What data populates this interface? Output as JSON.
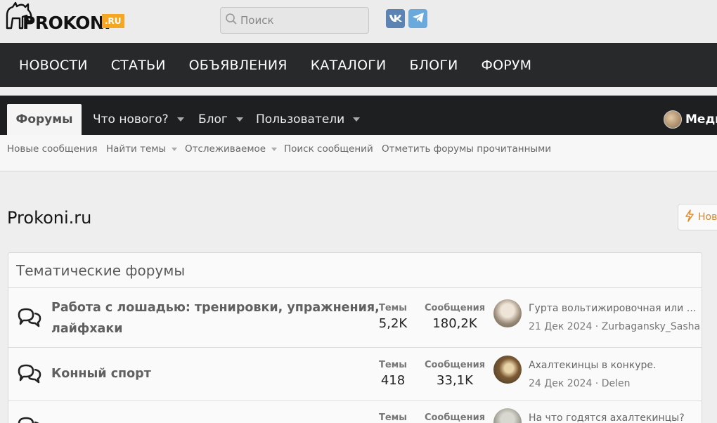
{
  "logo": {
    "text": "PROKONI",
    "suffix": ".RU"
  },
  "search": {
    "placeholder": "Поиск"
  },
  "social": {
    "vk": "vk-icon",
    "telegram": "telegram-icon"
  },
  "main_nav": [
    "НОВОСТИ",
    "СТАТЬИ",
    "ОБЪЯВЛЕНИЯ",
    "КАТАЛОГИ",
    "БЛОГИ",
    "ФОРУМ"
  ],
  "forum_nav": {
    "active": "Форумы",
    "whats_new": "Что нового?",
    "blog": "Блог",
    "users": "Пользователи",
    "user_name": "Медв"
  },
  "sub_nav": {
    "new_posts": "Новые сообщения",
    "find_threads": "Найти темы",
    "watched": "Отслеживаемое",
    "search_posts": "Поиск сообщений",
    "mark_read": "Отметить форумы прочитанными"
  },
  "page": {
    "title": "Prokoni.ru",
    "new_button": "Нов"
  },
  "block": {
    "title": "Тематические форумы",
    "rows": [
      {
        "title_line1": "Работа с лошадью: тренировки, упражнения,",
        "title_line2": "лайфхаки",
        "threads_label": "Темы",
        "threads": "5,2K",
        "messages_label": "Сообщения",
        "messages": "180,2K",
        "last_title": "Гурта вольтижировочная или седельная?",
        "last_meta": "21 Дек 2024 · Zurbagansky_Sasha"
      },
      {
        "title_line1": "Конный спорт",
        "threads_label": "Темы",
        "threads": "418",
        "messages_label": "Сообщения",
        "messages": "33,1K",
        "last_title": "Ахалтекинцы в конкуре.",
        "last_meta": "24 Дек 2024 · Delen"
      },
      {
        "threads_label": "Темы",
        "messages_label": "Сообщения",
        "last_title": "На что годятся ахалтекинцы?"
      }
    ]
  }
}
